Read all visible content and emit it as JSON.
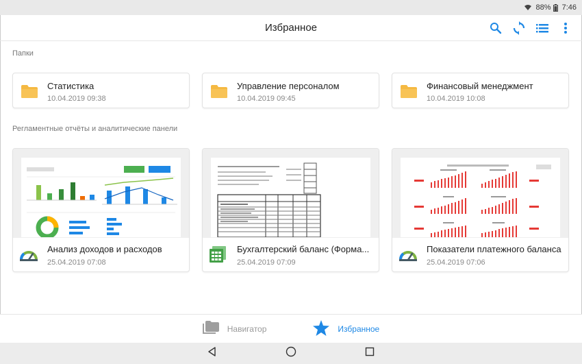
{
  "status": {
    "battery": "88%",
    "time": "7:46"
  },
  "appbar": {
    "title": "Избранное",
    "icons": [
      "search-icon",
      "sync-icon",
      "list-view-icon",
      "more-vert-icon"
    ]
  },
  "sections": {
    "folders_label": "Папки",
    "reports_label": "Регламентные отчёты и аналитические панели"
  },
  "folders": [
    {
      "name": "Статистика",
      "date": "10.04.2019 09:38"
    },
    {
      "name": "Управление персоналом",
      "date": "10.04.2019 09:45"
    },
    {
      "name": "Финансовый менеджмент",
      "date": "10.04.2019 10:08"
    }
  ],
  "reports": [
    {
      "name": "Анализ доходов и расходов",
      "date": "25.04.2019 07:08",
      "icon": "dashboard-gauge-icon"
    },
    {
      "name": "Бухгалтерский баланс (Форма...",
      "date": "25.04.2019 07:09",
      "icon": "spreadsheet-icon"
    },
    {
      "name": "Показатели платежного баланса",
      "date": "25.04.2019 07:06",
      "icon": "dashboard-gauge-icon"
    }
  ],
  "bottomnav": {
    "navigator_label": "Навигатор",
    "favorites_label": "Избранное"
  },
  "colors": {
    "accent": "#1e88e5",
    "folder": "#f5b942",
    "chart_red": "#e53935"
  }
}
